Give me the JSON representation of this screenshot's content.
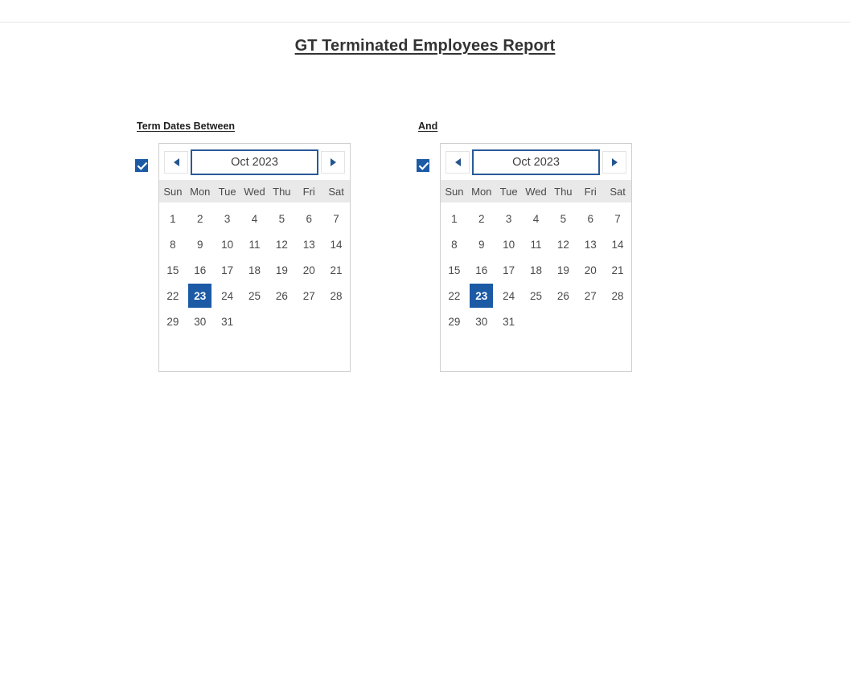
{
  "header": {
    "title": "GT Terminated Employees Report"
  },
  "colors": {
    "accent_blue": "#1c5aa6",
    "month_border_blue": "#2a5998",
    "dow_header_bg": "#e9e9e9",
    "panel_border": "#cfcfcf",
    "title_text": "#333333"
  },
  "filters": [
    {
      "id": "term-dates-between",
      "label": "Term Dates Between",
      "checkbox": {
        "checked": true,
        "icon": "check-icon"
      },
      "calendar": {
        "prev_icon": "chevron-left-icon",
        "next_icon": "chevron-right-icon",
        "month_label": "Oct 2023",
        "day_names": [
          "Sun",
          "Mon",
          "Tue",
          "Wed",
          "Thu",
          "Fri",
          "Sat"
        ],
        "leading_blanks": 0,
        "days": [
          1,
          2,
          3,
          4,
          5,
          6,
          7,
          8,
          9,
          10,
          11,
          12,
          13,
          14,
          15,
          16,
          17,
          18,
          19,
          20,
          21,
          22,
          23,
          24,
          25,
          26,
          27,
          28,
          29,
          30,
          31
        ],
        "selected_day": 23
      }
    },
    {
      "id": "and",
      "label": "And",
      "checkbox": {
        "checked": true,
        "icon": "check-icon"
      },
      "calendar": {
        "prev_icon": "chevron-left-icon",
        "next_icon": "chevron-right-icon",
        "month_label": "Oct 2023",
        "day_names": [
          "Sun",
          "Mon",
          "Tue",
          "Wed",
          "Thu",
          "Fri",
          "Sat"
        ],
        "leading_blanks": 0,
        "days": [
          1,
          2,
          3,
          4,
          5,
          6,
          7,
          8,
          9,
          10,
          11,
          12,
          13,
          14,
          15,
          16,
          17,
          18,
          19,
          20,
          21,
          22,
          23,
          24,
          25,
          26,
          27,
          28,
          29,
          30,
          31
        ],
        "selected_day": 23
      }
    }
  ]
}
